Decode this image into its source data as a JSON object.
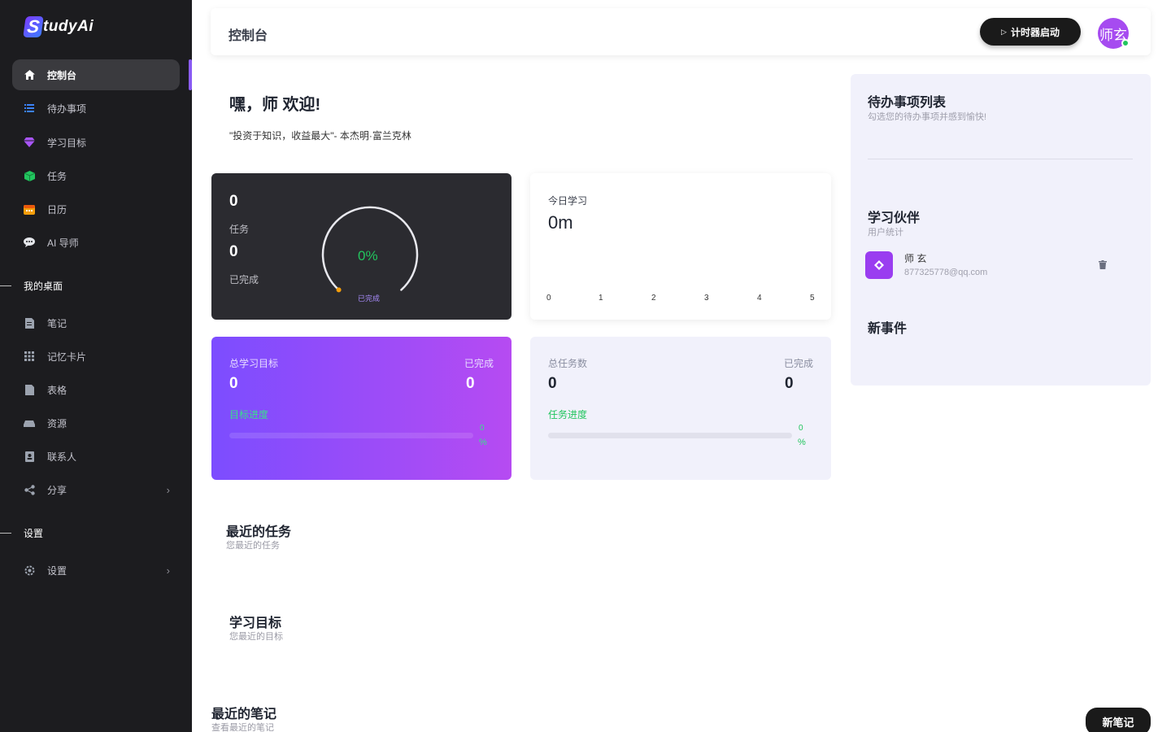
{
  "app": {
    "logo_letter": "S",
    "logo_text": "tudyAi"
  },
  "sidebar": {
    "items": [
      {
        "label": "控制台",
        "icon": "home-icon"
      },
      {
        "label": "待办事项",
        "icon": "list-icon"
      },
      {
        "label": "学习目标",
        "icon": "gem-icon"
      },
      {
        "label": "任务",
        "icon": "cube-icon"
      },
      {
        "label": "日历",
        "icon": "calendar-icon"
      },
      {
        "label": "AI 导师",
        "icon": "chat-icon"
      }
    ],
    "section_desk": "我的桌面",
    "desk_items": [
      {
        "label": "笔记",
        "icon": "note-icon"
      },
      {
        "label": "记忆卡片",
        "icon": "grid-icon"
      },
      {
        "label": "表格",
        "icon": "sheet-icon"
      },
      {
        "label": "资源",
        "icon": "resource-icon"
      },
      {
        "label": "联系人",
        "icon": "contact-icon"
      },
      {
        "label": "分享",
        "icon": "share-icon"
      }
    ],
    "section_settings": "设置",
    "settings_item": {
      "label": "设置",
      "icon": "gear-icon"
    }
  },
  "header": {
    "title": "控制台",
    "timer_button": "计时器启动",
    "avatar_text": "师玄"
  },
  "greeting": {
    "title": "嘿，师 欢迎!",
    "quote": "\"投资于知识，收益最大\"- 本杰明·富兰克林"
  },
  "task_card": {
    "tasks_value": "0",
    "tasks_label": "任务",
    "done_value": "0",
    "done_label": "已完成",
    "gauge_percent": "0%",
    "gauge_label": "已完成",
    "gauge_value": 0
  },
  "study_card": {
    "title": "今日学习",
    "value": "0m",
    "axis_ticks": [
      "0",
      "1",
      "2",
      "3",
      "4",
      "5"
    ]
  },
  "goal_card": {
    "left_title": "总学习目标",
    "left_value": "0",
    "right_title": "已完成",
    "right_value": "0",
    "progress_label": "目标进度",
    "progress_number": "0",
    "progress_symbol": "%",
    "progress_value": 0
  },
  "taskstat_card": {
    "left_title": "总任务数",
    "left_value": "0",
    "right_title": "已完成",
    "right_value": "0",
    "progress_label": "任务进度",
    "progress_number": "0",
    "progress_symbol": "%",
    "progress_value": 0
  },
  "recent_tasks": {
    "title": "最近的任务",
    "subtitle": "您最近的任务"
  },
  "study_goals": {
    "title": "学习目标",
    "subtitle": "您最近的目标"
  },
  "recent_notes": {
    "title": "最近的笔记",
    "subtitle": "查看最近的笔记",
    "new_button": "新笔记"
  },
  "right_panel": {
    "todo_title": "待办事项列表",
    "todo_subtitle": "勾选您的待办事项并感到愉快!",
    "partner_title": "学习伙伴",
    "partner_subtitle": "用户统计",
    "partner_name": "师 玄",
    "partner_email": "877325778@qq.com",
    "events_title": "新事件"
  },
  "colors": {
    "accent": "#8b5cf6",
    "success": "#22c55e",
    "sidebar_bg": "#1c1c1f"
  }
}
